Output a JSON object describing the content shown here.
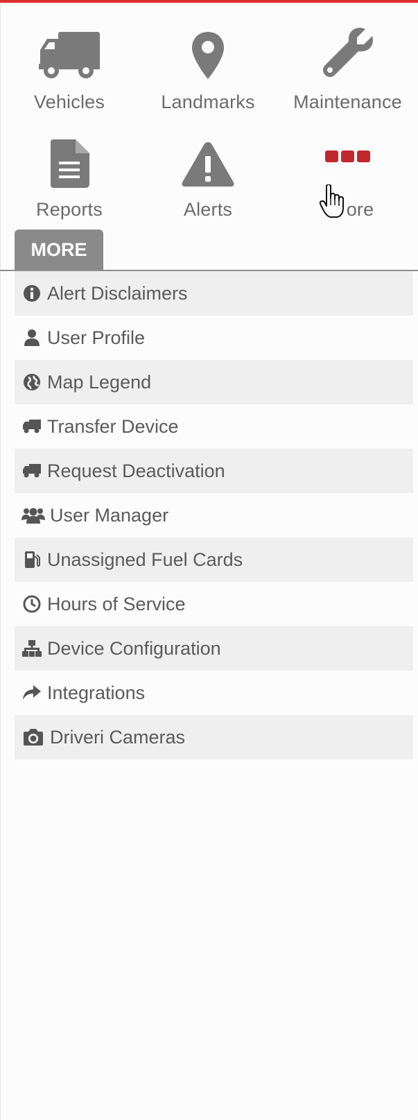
{
  "colors": {
    "accent": "#e02d2d",
    "icon_gray": "#7a7a7a",
    "more_dots": "#c0282d",
    "tab_bg": "#8a8a8a"
  },
  "nav": {
    "items": [
      {
        "label": "Vehicles",
        "icon": "truck-icon"
      },
      {
        "label": "Landmarks",
        "icon": "map-pin-icon"
      },
      {
        "label": "Maintenance",
        "icon": "wrench-icon"
      },
      {
        "label": "Reports",
        "icon": "document-icon"
      },
      {
        "label": "Alerts",
        "icon": "warning-icon"
      },
      {
        "label": "ore",
        "icon": "more-dots-icon"
      }
    ]
  },
  "tab": {
    "label": "MORE"
  },
  "menu": {
    "items": [
      {
        "label": "Alert Disclaimers",
        "icon": "info-circle-icon"
      },
      {
        "label": "User Profile",
        "icon": "user-icon"
      },
      {
        "label": "Map Legend",
        "icon": "globe-icon"
      },
      {
        "label": "Transfer Device",
        "icon": "truck-small-icon"
      },
      {
        "label": "Request Deactivation",
        "icon": "truck-small-icon"
      },
      {
        "label": "User Manager",
        "icon": "users-icon"
      },
      {
        "label": "Unassigned Fuel Cards",
        "icon": "fuel-pump-icon"
      },
      {
        "label": "Hours of Service",
        "icon": "clock-icon"
      },
      {
        "label": "Device Configuration",
        "icon": "sitemap-icon"
      },
      {
        "label": "Integrations",
        "icon": "share-arrow-icon"
      },
      {
        "label": "Driveri Cameras",
        "icon": "camera-icon"
      }
    ]
  }
}
